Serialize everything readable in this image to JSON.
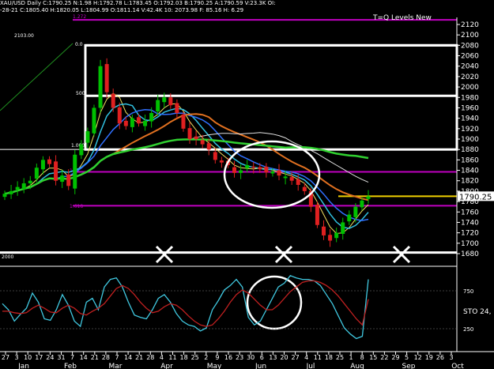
{
  "header": {
    "line1": "XAU/USD Daily  C:1790.25  N:1.98  H:1792.78  L:1783.45  O:1792.03  B:1790.25  A:1790.59  V:23.3K  OI:",
    "line2": "-28-21  C:1805.40  H:1820.05  L:1804.99  O:1811.14  V:42.4K  10: 2073.98  F: 85.16  H: 6.29"
  },
  "watermark": "T=Q Levels New",
  "oscillator": {
    "label": "STO  24,"
  },
  "colors": {
    "background": "#000000",
    "candle_up": "#00c000",
    "candle_down": "#e02020",
    "fib_magenta": "#c000c0",
    "last_price_line": "#f0d000",
    "ma_orange": "#e07020",
    "ma_green": "#30d030",
    "ma_blue": "#3070ff",
    "ma_cyan": "#30c0e0",
    "ma_yellow": "#f0e060",
    "ma_white": "#e0e0e0",
    "sto_fast": "#40c8e0",
    "sto_slow": "#c02020"
  },
  "chart_data": [
    {
      "type": "candlestick",
      "title": "XAU/USD Daily",
      "y_ticks": [
        1680,
        1700,
        1720,
        1740,
        1760,
        1780,
        1800,
        1820,
        1840,
        1860,
        1880,
        1900,
        1920,
        1940,
        1960,
        1980,
        2000,
        2020,
        2040,
        2060,
        2080,
        2100,
        2120
      ],
      "ylim": [
        1665,
        2135
      ],
      "last_price": 1790.25,
      "x_tick_labels": [
        "27",
        "3",
        "10",
        "17",
        "24",
        "31",
        "7",
        "14",
        "21",
        "28",
        "7",
        "14",
        "21",
        "28",
        "4",
        "11",
        "18",
        "25",
        "2",
        "9",
        "16",
        "23",
        "30",
        "6",
        "13",
        "20",
        "27",
        "4",
        "11",
        "18",
        "25",
        "1",
        "8",
        "15",
        "22",
        "29",
        "5",
        "12",
        "19",
        "26",
        "3"
      ],
      "month_labels": [
        "Jan",
        "Feb",
        "Mar",
        "Apr",
        "May",
        "Jun",
        "Jul",
        "Aug",
        "Sep",
        "Oct"
      ],
      "level_labels": [
        "2103.00",
        "1.272",
        "0.0",
        "500",
        "1.000",
        "1.61",
        "1.618",
        "2000"
      ],
      "fib_levels": [
        2129,
        1837,
        1772
      ],
      "white_levels": [
        2080,
        1983,
        1880,
        1682
      ],
      "box": {
        "x_start": "Feb 28",
        "x_end": "Sep 30",
        "y_top": 2080,
        "y_bottom": 1880
      },
      "close_series_approx": [
        1795,
        1800,
        1808,
        1815,
        1820,
        1845,
        1860,
        1852,
        1820,
        1830,
        1810,
        1870,
        1890,
        1915,
        1960,
        2040,
        1990,
        1960,
        1930,
        1925,
        1940,
        1930,
        1935,
        1950,
        1975,
        1980,
        1965,
        1950,
        1920,
        1900,
        1900,
        1890,
        1880,
        1860,
        1855,
        1850,
        1835,
        1840,
        1850,
        1845,
        1842,
        1836,
        1838,
        1830,
        1828,
        1820,
        1812,
        1800,
        1770,
        1735,
        1715,
        1705,
        1720,
        1740,
        1755,
        1770,
        1782,
        1790
      ],
      "x_markers": [
        "Apr 4",
        "Jun 13",
        "Aug 29"
      ]
    },
    {
      "type": "line",
      "title": "STO 24",
      "y_ticks": [
        250,
        750
      ],
      "ylim": [
        0,
        1000
      ],
      "series": [
        {
          "values": [
            580,
            500,
            350,
            440,
            520,
            720,
            600,
            380,
            360,
            500,
            700,
            560,
            350,
            280,
            600,
            650,
            500,
            800,
            900,
            920,
            800,
            600,
            430,
            400,
            380,
            500,
            650,
            700,
            600,
            450,
            350,
            300,
            280,
            220,
            260,
            500,
            620,
            760,
            820,
            900,
            800,
            400,
            300,
            350,
            500,
            650,
            800,
            850,
            950,
            920,
            900,
            900,
            880,
            820,
            700,
            580,
            420,
            260,
            180,
            120,
            150,
            900
          ]
        },
        {
          "values": [
            480,
            480,
            460,
            450,
            460,
            520,
            560,
            520,
            470,
            460,
            520,
            560,
            520,
            450,
            430,
            480,
            520,
            580,
            680,
            780,
            820,
            780,
            700,
            600,
            520,
            460,
            480,
            540,
            580,
            560,
            500,
            420,
            350,
            300,
            280,
            300,
            380,
            480,
            600,
            700,
            760,
            720,
            640,
            560,
            500,
            500,
            560,
            650,
            740,
            800,
            860,
            880,
            880,
            860,
            820,
            760,
            680,
            580,
            480,
            380,
            300,
            640
          ]
        }
      ]
    }
  ]
}
